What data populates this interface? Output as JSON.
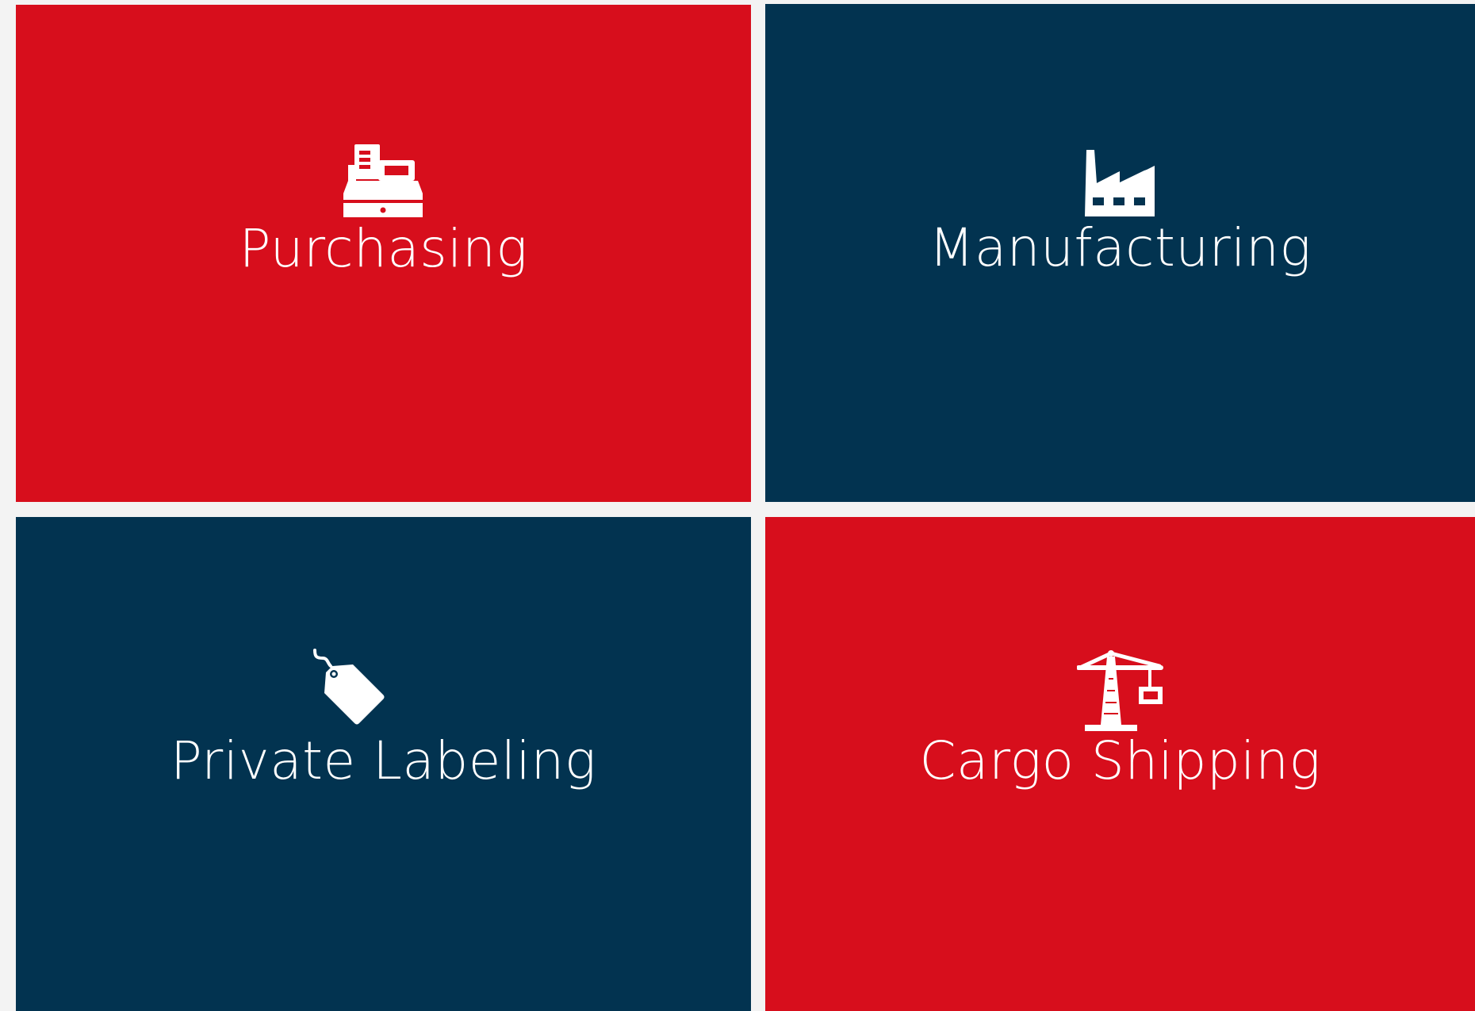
{
  "colors": {
    "red": "#d70e1c",
    "navy": "#023350",
    "gutter": "#f3f3f3",
    "text": "#ffffff"
  },
  "tiles": [
    {
      "label": "Purchasing",
      "icon": "cash-register-icon",
      "color": "red"
    },
    {
      "label": "Manufacturing",
      "icon": "factory-icon",
      "color": "navy"
    },
    {
      "label": "Private Labeling",
      "icon": "price-tag-icon",
      "color": "navy"
    },
    {
      "label": "Cargo Shipping",
      "icon": "crane-icon",
      "color": "red"
    }
  ]
}
